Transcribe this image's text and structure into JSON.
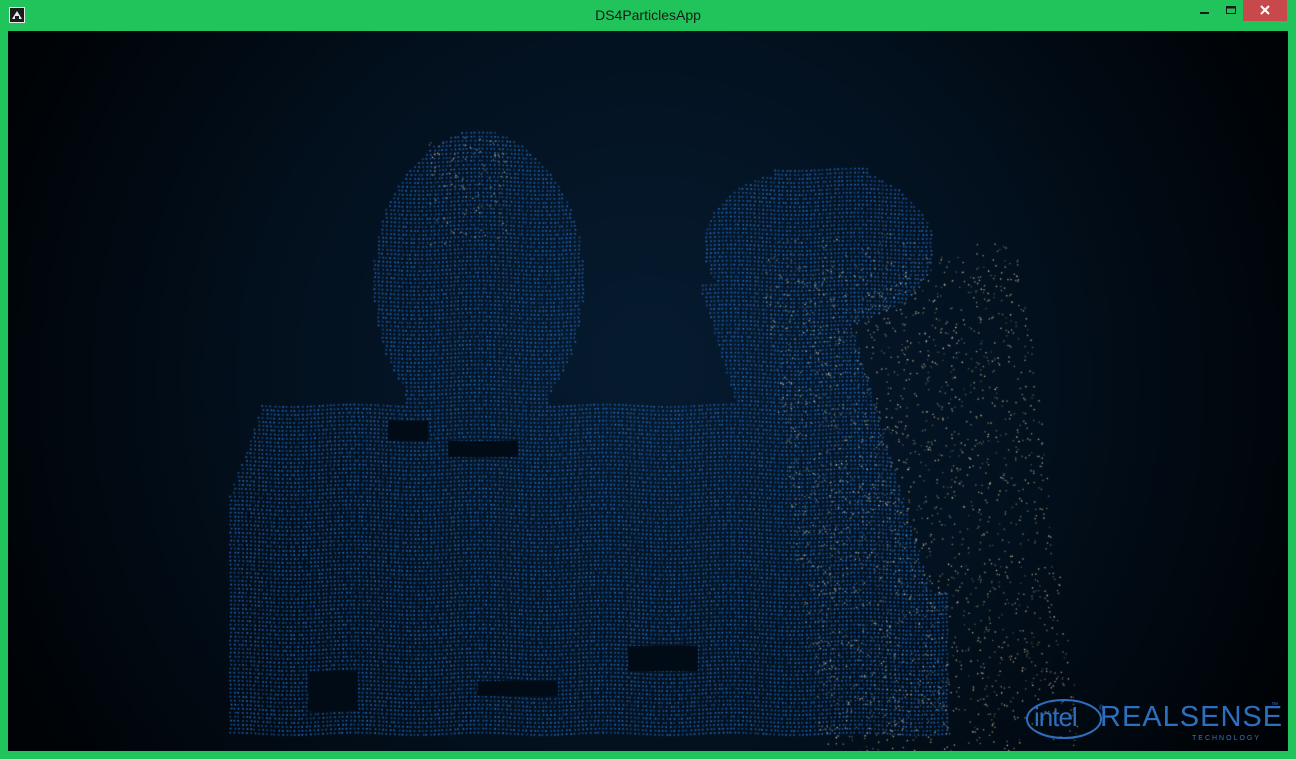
{
  "window": {
    "title": "DS4ParticlesApp",
    "frame_color": "#22c55e",
    "close_color": "#c7494c"
  },
  "controls": {
    "minimize_icon": "minimize-icon",
    "maximize_icon": "maximize-icon",
    "close_icon": "close-icon"
  },
  "scene": {
    "background": "#000000",
    "particle_color": "#2a76d4",
    "spark_color": "#c8b48c",
    "description_icon": "depth-point-cloud"
  },
  "logo": {
    "intel": "intel",
    "tm": "®",
    "realsense": "REALSENSE",
    "technology": "TECHNOLOGY",
    "trademark": "™"
  }
}
